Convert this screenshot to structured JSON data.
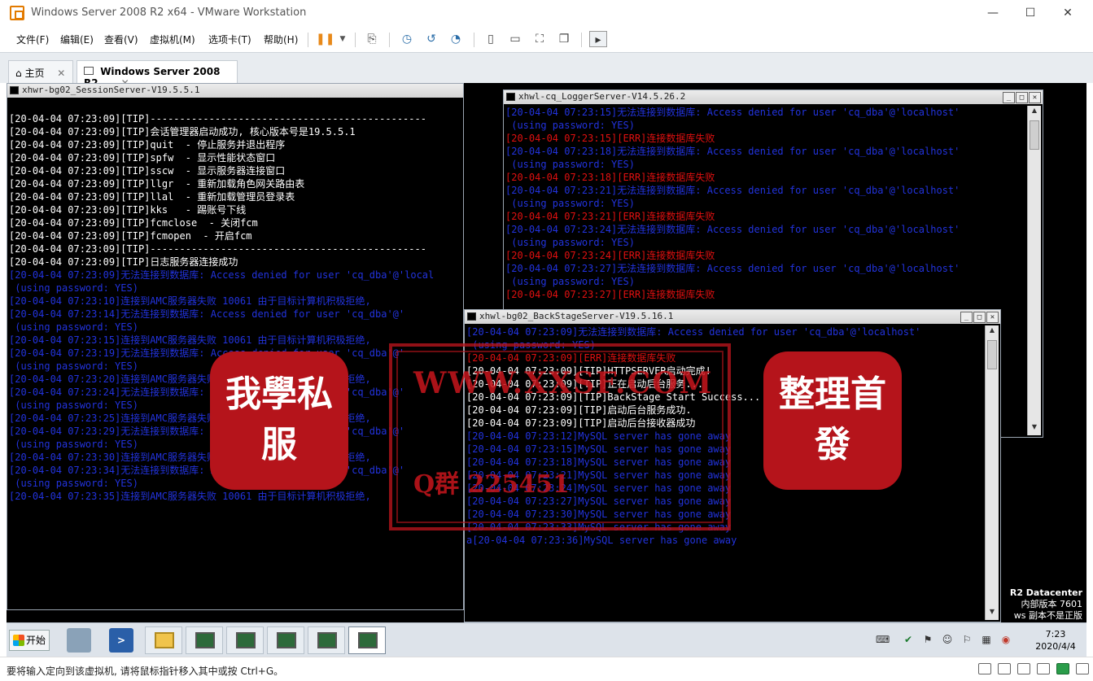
{
  "window": {
    "title": "Windows Server 2008 R2 x64 - VMware Workstation",
    "minimize": "—",
    "maximize": "☐",
    "close": "✕"
  },
  "menu": {
    "items": [
      "文件(F)",
      "编辑(E)",
      "查看(V)",
      "虚拟机(M)",
      "选项卡(T)",
      "帮助(H)"
    ]
  },
  "tabs": {
    "home": "主页",
    "vm": "Windows Server 2008 R2 ...",
    "close": "✕"
  },
  "session_console": {
    "title": "xhwr-bg02_SessionServer-V19.5.5.1",
    "lines": [
      {
        "text": "",
        "c": "w"
      },
      {
        "text": "[20-04-04 07:23:09][TIP]-----------------------------------------------",
        "c": "w"
      },
      {
        "text": "[20-04-04 07:23:09][TIP]会话管理器启动成功, 核心版本号是19.5.5.1",
        "c": "w"
      },
      {
        "text": "[20-04-04 07:23:09][TIP]quit  - 停止服务并退出程序",
        "c": "w"
      },
      {
        "text": "[20-04-04 07:23:09][TIP]spfw  - 显示性能状态窗口",
        "c": "w"
      },
      {
        "text": "[20-04-04 07:23:09][TIP]sscw  - 显示服务器连接窗口",
        "c": "w"
      },
      {
        "text": "[20-04-04 07:23:09][TIP]llgr  - 重新加载角色网关路由表",
        "c": "w"
      },
      {
        "text": "[20-04-04 07:23:09][TIP]llal  - 重新加载管理员登录表",
        "c": "w"
      },
      {
        "text": "[20-04-04 07:23:09][TIP]kks   - 踢账号下线",
        "c": "w"
      },
      {
        "text": "[20-04-04 07:23:09][TIP]fcmclose  - 关闭fcm",
        "c": "w"
      },
      {
        "text": "[20-04-04 07:23:09][TIP]fcmopen  - 开启fcm",
        "c": "w"
      },
      {
        "text": "[20-04-04 07:23:09][TIP]-----------------------------------------------",
        "c": "w"
      },
      {
        "text": "[20-04-04 07:23:09][TIP]日志服务器连接成功",
        "c": "w"
      },
      {
        "text": "[20-04-04 07:23:09]无法连接到数据库: Access denied for user 'cq_dba'@'local",
        "c": "b"
      },
      {
        "text": " (using password: YES)",
        "c": "b"
      },
      {
        "text": "[20-04-04 07:23:10]连接到AMC服务器失败 10061 由于目标计算机积极拒绝,",
        "c": "b"
      },
      {
        "text": "[20-04-04 07:23:14]无法连接到数据库: Access denied for user 'cq_dba'@'",
        "c": "b"
      },
      {
        "text": " (using password: YES)",
        "c": "b"
      },
      {
        "text": "[20-04-04 07:23:15]连接到AMC服务器失败 10061 由于目标计算机积极拒绝,",
        "c": "b"
      },
      {
        "text": "[20-04-04 07:23:19]无法连接到数据库: Access denied for user 'cq_dba'@'",
        "c": "b"
      },
      {
        "text": " (using password: YES)",
        "c": "b"
      },
      {
        "text": "[20-04-04 07:23:20]连接到AMC服务器失败 10061 由于目标计算机积极拒绝,",
        "c": "b"
      },
      {
        "text": "[20-04-04 07:23:24]无法连接到数据库: Access denied for user 'cq_dba'@'",
        "c": "b"
      },
      {
        "text": " (using password: YES)",
        "c": "b"
      },
      {
        "text": "[20-04-04 07:23:25]连接到AMC服务器失败 10061 由于目标计算机积极拒绝,",
        "c": "b"
      },
      {
        "text": "[20-04-04 07:23:29]无法连接到数据库: Access denied for user 'cq_dba'@'",
        "c": "b"
      },
      {
        "text": " (using password: YES)",
        "c": "b"
      },
      {
        "text": "[20-04-04 07:23:30]连接到AMC服务器失败 10061 由于目标计算机积极拒绝,",
        "c": "b"
      },
      {
        "text": "[20-04-04 07:23:34]无法连接到数据库: Access denied for user 'cq_dba'@'",
        "c": "b"
      },
      {
        "text": " (using password: YES)",
        "c": "b"
      },
      {
        "text": "[20-04-04 07:23:35]连接到AMC服务器失败 10061 由于目标计算机积极拒绝,",
        "c": "b"
      }
    ]
  },
  "logger_console": {
    "title": "xhwl-cq_LoggerServer-V14.5.26.2",
    "lines": [
      {
        "text": "[20-04-04 07:23:15]无法连接到数据库: Access denied for user 'cq_dba'@'localhost'",
        "c": "b"
      },
      {
        "text": " (using password: YES)",
        "c": "b"
      },
      {
        "text": "[20-04-04 07:23:15][ERR]连接数据库失败",
        "c": "r"
      },
      {
        "text": "[20-04-04 07:23:18]无法连接到数据库: Access denied for user 'cq_dba'@'localhost'",
        "c": "b"
      },
      {
        "text": " (using password: YES)",
        "c": "b"
      },
      {
        "text": "[20-04-04 07:23:18][ERR]连接数据库失败",
        "c": "r"
      },
      {
        "text": "[20-04-04 07:23:21]无法连接到数据库: Access denied for user 'cq_dba'@'localhost'",
        "c": "b"
      },
      {
        "text": " (using password: YES)",
        "c": "b"
      },
      {
        "text": "[20-04-04 07:23:21][ERR]连接数据库失败",
        "c": "r"
      },
      {
        "text": "[20-04-04 07:23:24]无法连接到数据库: Access denied for user 'cq_dba'@'localhost'",
        "c": "b"
      },
      {
        "text": " (using password: YES)",
        "c": "b"
      },
      {
        "text": "[20-04-04 07:23:24][ERR]连接数据库失败",
        "c": "r"
      },
      {
        "text": "[20-04-04 07:23:27]无法连接到数据库: Access denied for user 'cq_dba'@'localhost'",
        "c": "b"
      },
      {
        "text": " (using password: YES)",
        "c": "b"
      },
      {
        "text": "[20-04-04 07:23:27][ERR]连接数据库失败",
        "c": "r"
      }
    ]
  },
  "backstage_console": {
    "title": "xhwl-bg02_BackStageServer-V19.5.16.1",
    "lines": [
      {
        "text": "[20-04-04 07:23:09]无法连接到数据库: Access denied for user 'cq_dba'@'localhost'",
        "c": "b"
      },
      {
        "text": " (using password: YES)",
        "c": "b"
      },
      {
        "text": "[20-04-04 07:23:09][ERR]连接数据库失败",
        "c": "r"
      },
      {
        "text": "[20-04-04 07:23:09][TIP]HTTPSERVER启动完成!",
        "c": "w"
      },
      {
        "text": "[20-04-04 07:23:09][TIP]正在启动后台服务...",
        "c": "w"
      },
      {
        "text": "[20-04-04 07:23:09][TIP]BackStage Start Success...",
        "c": "w"
      },
      {
        "text": "[20-04-04 07:23:09][TIP]启动后台服务成功.",
        "c": "w"
      },
      {
        "text": "[20-04-04 07:23:09][TIP]启动后台接收器成功",
        "c": "w"
      },
      {
        "text": "[20-04-04 07:23:12]MySQL server has gone away",
        "c": "b"
      },
      {
        "text": "[20-04-04 07:23:15]MySQL server has gone away",
        "c": "b"
      },
      {
        "text": "[20-04-04 07:23:18]MySQL server has gone away",
        "c": "b"
      },
      {
        "text": "[20-04-04 07:23:21]MySQL server has gone away",
        "c": "b"
      },
      {
        "text": "[20-04-04 07:23:24]MySQL server has gone away",
        "c": "b"
      },
      {
        "text": "[20-04-04 07:23:27]MySQL server has gone away",
        "c": "b"
      },
      {
        "text": "[20-04-04 07:23:30]MySQL server has gone away",
        "c": "b"
      },
      {
        "text": "[20-04-04 07:23:33]MySQL server has gone away",
        "c": "b"
      },
      {
        "text": "a[20-04-04 07:23:36]MySQL server has gone away",
        "c": "b"
      }
    ]
  },
  "watermark": {
    "left_seal": "我學私服",
    "right_seal": "整理首發",
    "url": "WWW.XXSF.COM",
    "qq": "Q群 225451",
    "color": "#b5141b"
  },
  "desktop": {
    "edition": "R2 Datacenter",
    "build": "内部版本 7601",
    "notice": "ws 副本不是正版"
  },
  "taskbar": {
    "start": "开始",
    "time": "7:23",
    "date": "2020/4/4"
  },
  "status": {
    "message": "要将输入定向到该虚拟机, 请将鼠标指针移入其中或按 Ctrl+G。"
  },
  "colors": {
    "console_white": "#ffffff",
    "console_blue": "#2233dd",
    "console_red": "#e01010",
    "accent": "#e27a00"
  }
}
